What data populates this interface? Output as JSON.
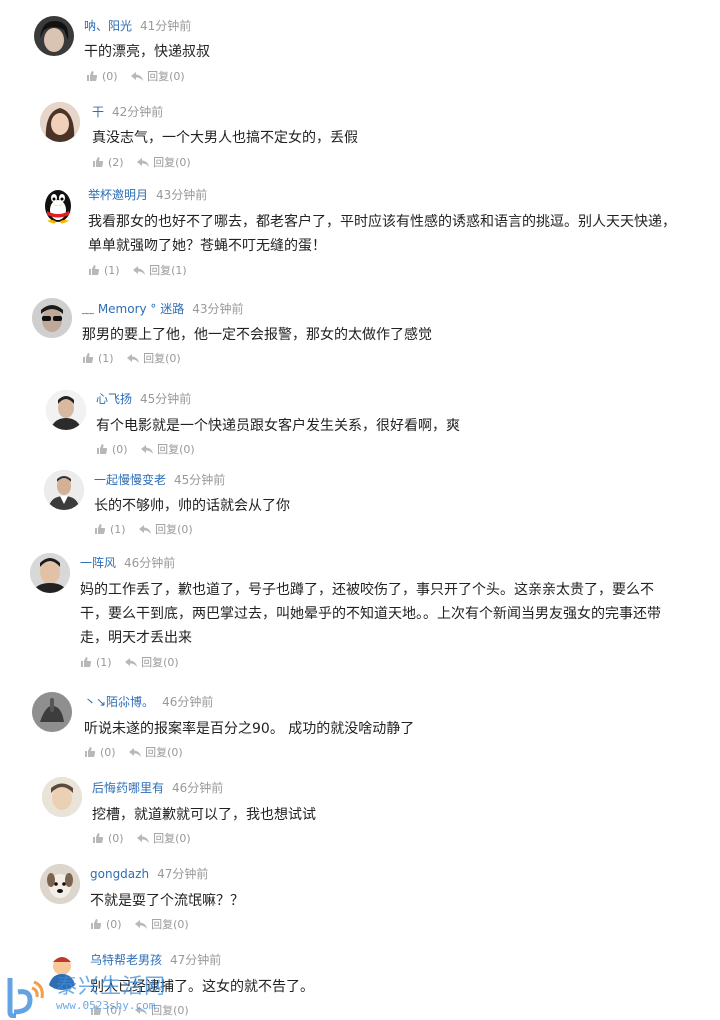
{
  "comments": [
    {
      "name": "呐、阳光",
      "time": "41分钟前",
      "text": "干的漂亮，快递叔叔",
      "likes": "(0)",
      "reply": "回复",
      "reply_count": "(0)",
      "avatar_icon": "avatar-dark-hair-icon"
    },
    {
      "name": "干",
      "time": "42分钟前",
      "text": "真没志气，一个大男人也搞不定女的，丢假",
      "likes": "(2)",
      "reply": "回复",
      "reply_count": "(0)",
      "avatar_icon": "avatar-woman-icon"
    },
    {
      "name": "举杯邀明月",
      "time": "43分钟前",
      "text": "我看那女的也好不了哪去，都老客户了，平时应该有性感的诱惑和语言的挑逗。别人天天快递，单单就强吻了她？苍蝇不叮无缝的蛋！",
      "likes": "(1)",
      "reply": "回复",
      "reply_count": "(1)",
      "avatar_icon": "qq-penguin-icon"
    },
    {
      "name": "﹏ Memory ° 迷路",
      "time": "43分钟前",
      "text": "那男的要上了他，他一定不会报警，那女的太做作了感觉",
      "likes": "(1)",
      "reply": "回复",
      "reply_count": "(0)",
      "avatar_icon": "avatar-sunglasses-icon"
    },
    {
      "name": "心飞扬",
      "time": "45分钟前",
      "text": "有个电影就是一个快递员跟女客户发生关系，很好看啊，爽",
      "likes": "(0)",
      "reply": "回复",
      "reply_count": "(0)",
      "avatar_icon": "avatar-man-icon"
    },
    {
      "name": "一起慢慢变老",
      "time": "45分钟前",
      "text": "长的不够帅，帅的话就会从了你",
      "likes": "(1)",
      "reply": "回复",
      "reply_count": "(0)",
      "avatar_icon": "avatar-man-shirt-icon"
    },
    {
      "name": "一阵风",
      "time": "46分钟前",
      "text": "妈的工作丢了，歉也道了，号子也蹲了，还被咬伤了，事只开了个头。这亲亲太贵了，要么不干，要么干到底，两巴掌过去，叫她晕乎的不知道天地。。上次有个新闻当男友强女的完事还带走，明天才丢出来",
      "likes": "(1)",
      "reply": "回复",
      "reply_count": "(0)",
      "avatar_icon": "avatar-man-portrait-icon"
    },
    {
      "name": "丶↘陌尛博。",
      "time": "46分钟前",
      "text": "听说未遂的报案率是百分之90。 成功的就没啥动静了",
      "likes": "(0)",
      "reply": "回复",
      "reply_count": "(0)",
      "avatar_icon": "avatar-hand-icon"
    },
    {
      "name": "后悔药哪里有",
      "time": "46分钟前",
      "text": "挖槽，就道歉就可以了，我也想试试",
      "likes": "(0)",
      "reply": "回复",
      "reply_count": "(0)",
      "avatar_icon": "avatar-boy-icon"
    },
    {
      "name": "gongdazh",
      "time": "47分钟前",
      "text": "不就是耍了个流氓嘛？？",
      "likes": "(0)",
      "reply": "回复",
      "reply_count": "(0)",
      "avatar_icon": "avatar-dog-icon"
    },
    {
      "name": "乌特帮老男孩",
      "time": "47分钟前",
      "text": "别人已经逮捕了。这女的就不告了。",
      "likes": "(0)",
      "reply": "回复",
      "reply_count": "(0)",
      "avatar_icon": "avatar-cartoon-icon"
    }
  ],
  "watermark": {
    "title": "泰兴生活网",
    "url": "www.0523shy.com"
  },
  "colors": {
    "name": "#2d6eb6",
    "time": "#999999",
    "text": "#222222"
  }
}
